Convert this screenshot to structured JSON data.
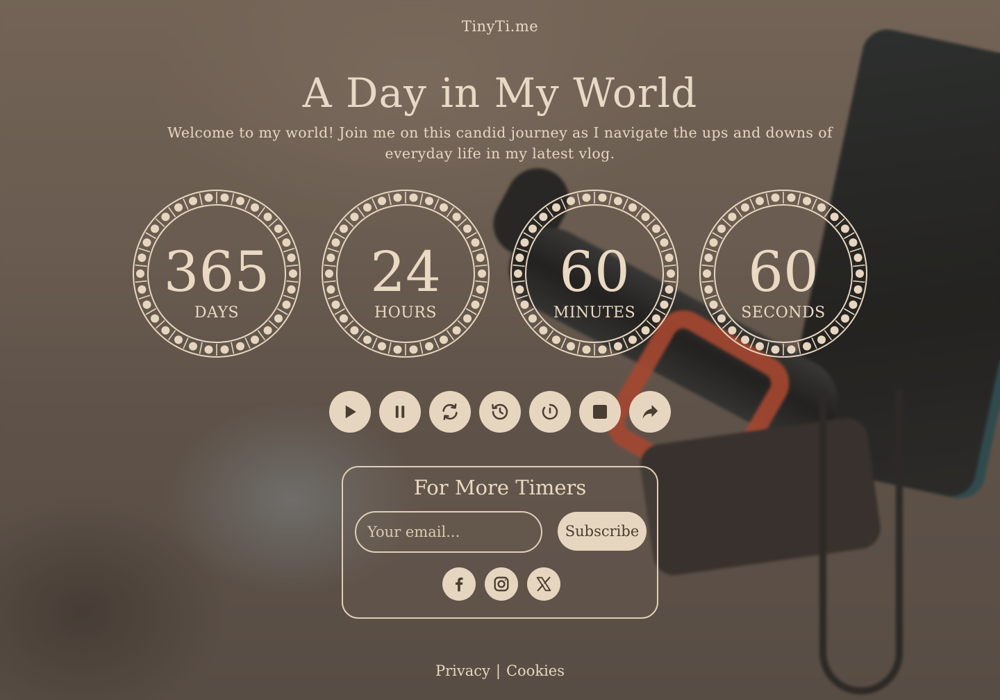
{
  "brand": "TinyTi.me",
  "hero": {
    "title": "A Day in My World",
    "subtitle": "Welcome to my world! Join me on this candid journey as I navigate the ups and downs of everyday life in my latest vlog."
  },
  "timers": [
    {
      "value": "365",
      "label": "DAYS"
    },
    {
      "value": "24",
      "label": "HOURS"
    },
    {
      "value": "60",
      "label": "MINUTES"
    },
    {
      "value": "60",
      "label": "SECONDS"
    }
  ],
  "controls": [
    {
      "icon": "play-icon"
    },
    {
      "icon": "pause-icon"
    },
    {
      "icon": "refresh-icon"
    },
    {
      "icon": "history-icon"
    },
    {
      "icon": "timer-icon"
    },
    {
      "icon": "stop-icon"
    },
    {
      "icon": "share-icon"
    }
  ],
  "subscribe": {
    "heading": "For More Timers",
    "email_placeholder": "Your email...",
    "button_label": "Subscribe"
  },
  "social": [
    "facebook-icon",
    "instagram-icon",
    "x-icon"
  ],
  "footer": {
    "privacy": "Privacy",
    "separator": "|",
    "cookies": "Cookies"
  },
  "colors": {
    "accent": "#e7d6bf",
    "text": "#e6d6c0",
    "icon_dark": "#4a3d31"
  }
}
